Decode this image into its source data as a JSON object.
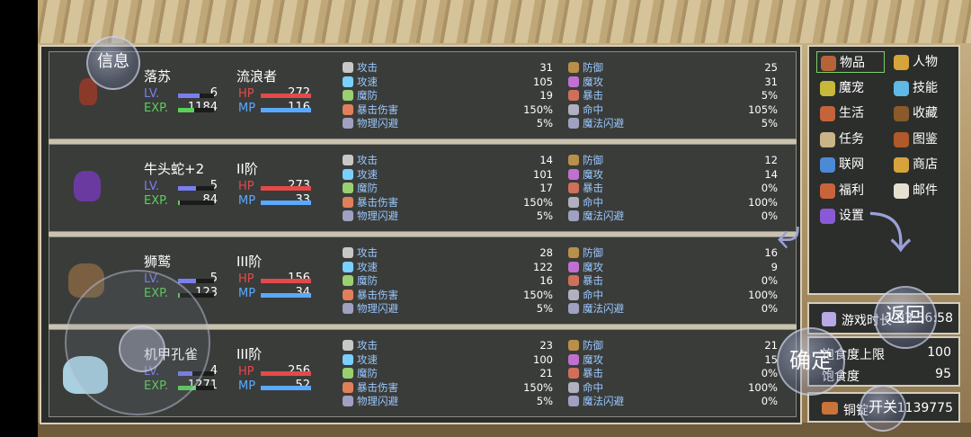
{
  "info_button": "信息",
  "party": [
    {
      "name": "落苏",
      "title": "流浪者",
      "lv_label": "LV.",
      "lv": "6",
      "exp_label": "EXP.",
      "exp": "1184",
      "hp_label": "HP",
      "hp": "272",
      "mp_label": "MP",
      "mp": "116",
      "lv_fill": 0.6,
      "exp_fill": 0.45,
      "hp_fill": 1.0,
      "mp_fill": 1.0,
      "sprite": "girl-sprite",
      "attrs": [
        {
          "label": "攻击",
          "value": "31",
          "label2": "防御",
          "value2": "25"
        },
        {
          "label": "攻速",
          "value": "105",
          "label2": "魔攻",
          "value2": "31"
        },
        {
          "label": "魔防",
          "value": "19",
          "label2": "暴击",
          "value2": "5%"
        },
        {
          "label": "暴击伤害",
          "value": "150%",
          "label2": "命中",
          "value2": "105%"
        },
        {
          "label": "物理闪避",
          "value": "5%",
          "label2": "魔法闪避",
          "value2": "5%"
        }
      ]
    },
    {
      "name": "牛头蛇+2",
      "title": "II阶",
      "lv_label": "LV.",
      "lv": "5",
      "exp_label": "EXP.",
      "exp": "84",
      "hp_label": "HP",
      "hp": "273",
      "mp_label": "MP",
      "mp": "33",
      "lv_fill": 0.5,
      "exp_fill": 0.05,
      "hp_fill": 1.0,
      "mp_fill": 1.0,
      "sprite": "snake-sprite",
      "attrs": [
        {
          "label": "攻击",
          "value": "14",
          "label2": "防御",
          "value2": "12"
        },
        {
          "label": "攻速",
          "value": "101",
          "label2": "魔攻",
          "value2": "14"
        },
        {
          "label": "魔防",
          "value": "17",
          "label2": "暴击",
          "value2": "0%"
        },
        {
          "label": "暴击伤害",
          "value": "150%",
          "label2": "命中",
          "value2": "100%"
        },
        {
          "label": "物理闪避",
          "value": "5%",
          "label2": "魔法闪避",
          "value2": "0%"
        }
      ]
    },
    {
      "name": "狮鹫",
      "title": "III阶",
      "lv_label": "LV.",
      "lv": "5",
      "exp_label": "EXP.",
      "exp": "123",
      "hp_label": "HP",
      "hp": "156",
      "mp_label": "MP",
      "mp": "34",
      "lv_fill": 0.5,
      "exp_fill": 0.05,
      "hp_fill": 1.0,
      "mp_fill": 1.0,
      "sprite": "griffin-sprite",
      "attrs": [
        {
          "label": "攻击",
          "value": "28",
          "label2": "防御",
          "value2": "16"
        },
        {
          "label": "攻速",
          "value": "122",
          "label2": "魔攻",
          "value2": "9"
        },
        {
          "label": "魔防",
          "value": "16",
          "label2": "暴击",
          "value2": "0%"
        },
        {
          "label": "暴击伤害",
          "value": "150%",
          "label2": "命中",
          "value2": "100%"
        },
        {
          "label": "物理闪避",
          "value": "5%",
          "label2": "魔法闪避",
          "value2": "0%"
        }
      ]
    },
    {
      "name": "机甲孔雀",
      "title": "III阶",
      "lv_label": "LV.",
      "lv": "4",
      "exp_label": "EXP.",
      "exp": "1271",
      "hp_label": "HP",
      "hp": "256",
      "mp_label": "MP",
      "mp": "52",
      "lv_fill": 0.4,
      "exp_fill": 0.5,
      "hp_fill": 1.0,
      "mp_fill": 1.0,
      "sprite": "peacock-sprite",
      "attrs": [
        {
          "label": "攻击",
          "value": "23",
          "label2": "防御",
          "value2": "21"
        },
        {
          "label": "攻速",
          "value": "100",
          "label2": "魔攻",
          "value2": "15"
        },
        {
          "label": "魔防",
          "value": "21",
          "label2": "暴击",
          "value2": "0%"
        },
        {
          "label": "暴击伤害",
          "value": "150%",
          "label2": "命中",
          "value2": "100%"
        },
        {
          "label": "物理闪避",
          "value": "5%",
          "label2": "魔法闪避",
          "value2": "0%"
        }
      ]
    }
  ],
  "menu": [
    {
      "label": "物品",
      "icon": "bag-icon",
      "color": "#b5643a",
      "selected": true
    },
    {
      "label": "人物",
      "icon": "helmet-icon",
      "color": "#d6a43a"
    },
    {
      "label": "魔宠",
      "icon": "egg-icon",
      "color": "#c9b93a"
    },
    {
      "label": "技能",
      "icon": "skill-icon",
      "color": "#5fb8e6"
    },
    {
      "label": "生活",
      "icon": "chest-icon",
      "color": "#c4643a"
    },
    {
      "label": "收藏",
      "icon": "book-icon",
      "color": "#8a5a2a"
    },
    {
      "label": "任务",
      "icon": "scroll-icon",
      "color": "#c9b48a"
    },
    {
      "label": "图鉴",
      "icon": "album-icon",
      "color": "#b05a2a"
    },
    {
      "label": "联网",
      "icon": "monitor-icon",
      "color": "#4a8ad6"
    },
    {
      "label": "商店",
      "icon": "shop-icon",
      "color": "#d6a43a"
    },
    {
      "label": "福利",
      "icon": "gift-icon",
      "color": "#c9643a"
    },
    {
      "label": "邮件",
      "icon": "mail-icon",
      "color": "#e6e0d0"
    },
    {
      "label": "设置",
      "icon": "gear-icon",
      "color": "#8a5ad6"
    }
  ],
  "playtime_label": "游戏时长",
  "playtime": "03:36:58",
  "satiety_max_label": "饱食度上限",
  "satiety_max": "100",
  "satiety_label": "饱食度",
  "satiety": "95",
  "copper_label": "铜锭",
  "copper": "1139775",
  "back_button": "返回",
  "confirm_button": "确定",
  "toggle_button": "开关"
}
